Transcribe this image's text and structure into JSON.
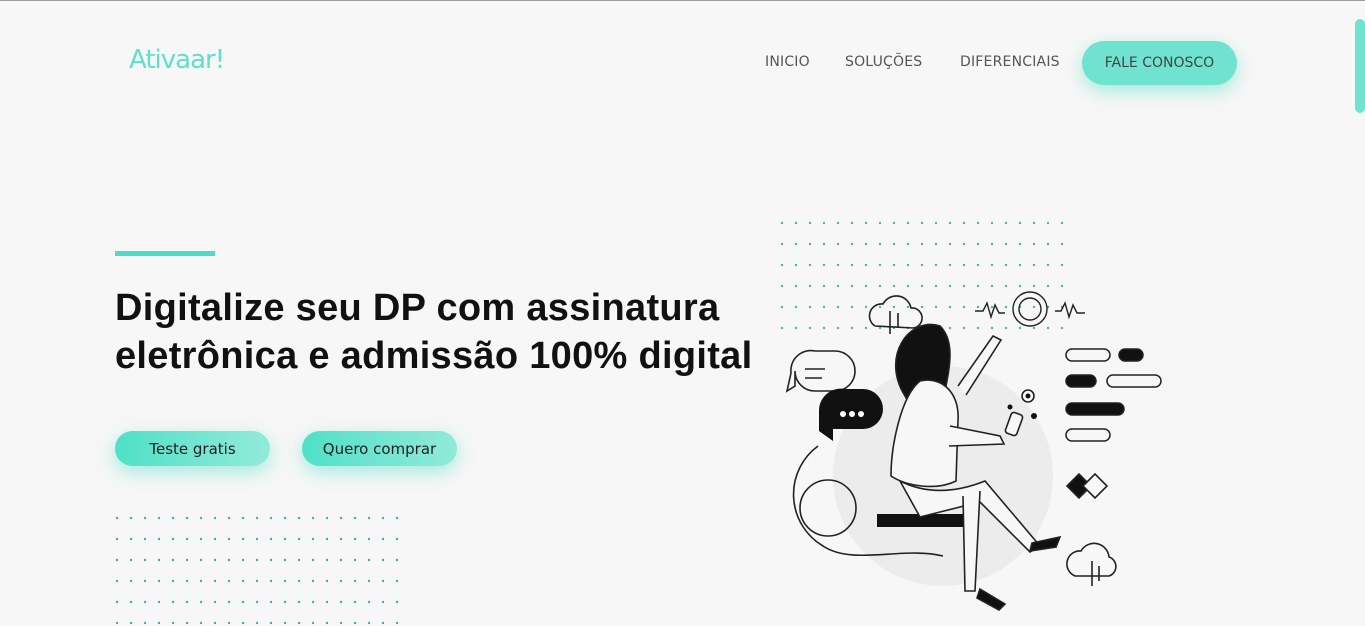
{
  "brand": {
    "logo_text": "Ativaar!",
    "accent_color": "#5fe0c8"
  },
  "nav": {
    "links": [
      {
        "label": "INICIO"
      },
      {
        "label": "SOLUÇÕES"
      },
      {
        "label": "DIFERENCIAIS"
      }
    ],
    "cta_label": "FALE CONOSCO"
  },
  "hero": {
    "headline": "Digitalize seu DP com assinatura eletrônica e admissão 100% digital",
    "primary_button": "Teste gratis",
    "secondary_button": "Quero comprar"
  }
}
